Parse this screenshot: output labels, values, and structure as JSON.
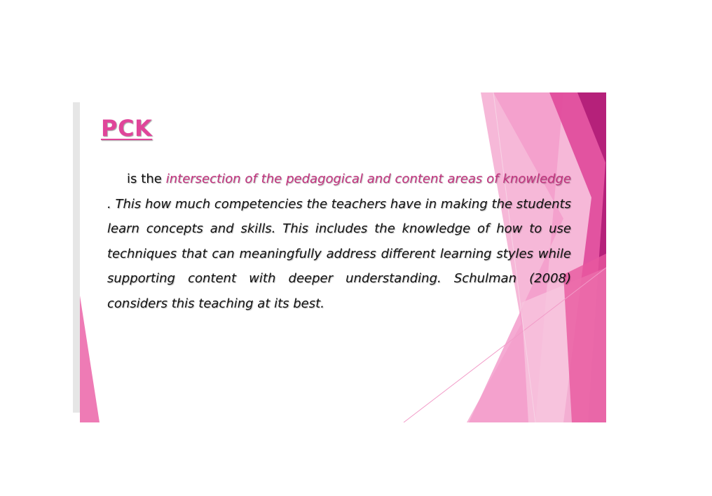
{
  "slide": {
    "title": "PCK",
    "paragraph": {
      "lead": "is the ",
      "emphasis": "intersection of  the pedagogical and content areas of knowledge",
      "rest": " . This how much competencies the teachers have in making the students learn concepts and skills. This includes the knowledge of how to use techniques  that can meaningfully address  different learning styles  while supporting  content with deeper understanding. Schulman (2008) considers  this teaching at its best."
    }
  },
  "colors": {
    "accent": "#e0459a",
    "emphasis_text": "#c2327e",
    "deep_magenta": "#b5217a",
    "light_pink": "#f7c6df"
  }
}
